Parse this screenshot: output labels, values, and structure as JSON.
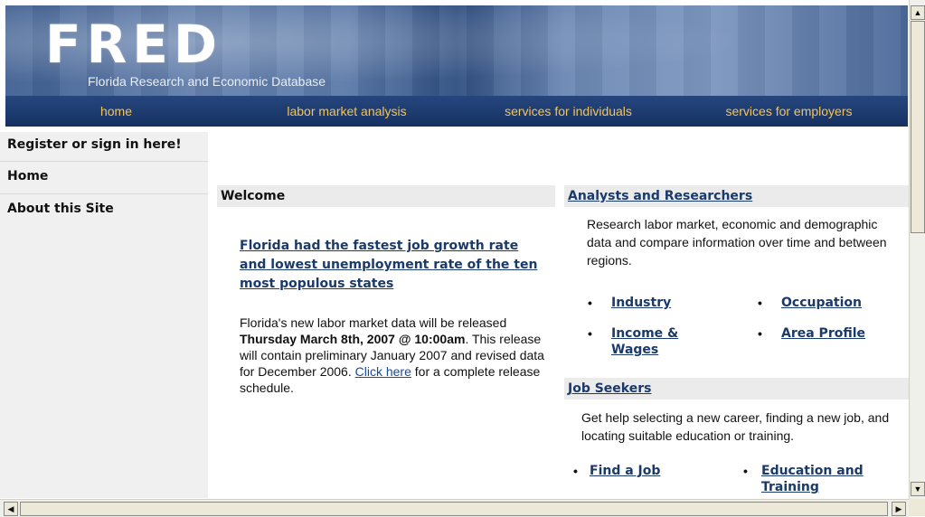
{
  "header": {
    "logo_text": "FRED",
    "subtitle": "Florida Research and Economic Database"
  },
  "nav": {
    "home": "home",
    "labor_market_analysis": "labor market analysis",
    "services_individuals": "services for individuals",
    "services_employers": "services for employers"
  },
  "sidebar": {
    "items": [
      {
        "label": "Register or sign in here!"
      },
      {
        "label": "Home"
      },
      {
        "label": "About this Site"
      }
    ]
  },
  "welcome": {
    "heading": "Welcome",
    "headline": "Florida had the fastest job growth rate and lowest unemployment rate of the ten most populous states",
    "release_part1": "Florida's new labor market data will be released ",
    "release_bold": "Thursday March 8th, 2007 @ 10:00am",
    "release_part2": ".  This release will contain preliminary January 2007 and revised data for December 2006.  ",
    "click_here": "Click here",
    "release_part3": " for a complete release schedule."
  },
  "analysts": {
    "heading": "Analysts and Researchers",
    "description": "Research labor market, economic and demographic data and compare information over time and between regions.",
    "links": {
      "industry": "Industry",
      "occupation": "Occupation",
      "income_wages_line1": "Income &",
      "income_wages_line2": "Wages",
      "area_profile": "Area Profile"
    }
  },
  "job_seekers": {
    "heading": "Job Seekers",
    "description": "Get help selecting a new career, finding a new job, and locating suitable education or training.",
    "links": {
      "find_job": "Find a Job",
      "education_line1": "Education and",
      "education_line2": "Training"
    }
  },
  "bullet_char": "•",
  "colors": {
    "nav_bg": "#1c3a6d",
    "nav_text": "#f5c458",
    "link": "#1a3a6b",
    "section_bg": "#ebebeb",
    "sidebar_bg": "#f0f0f0"
  }
}
